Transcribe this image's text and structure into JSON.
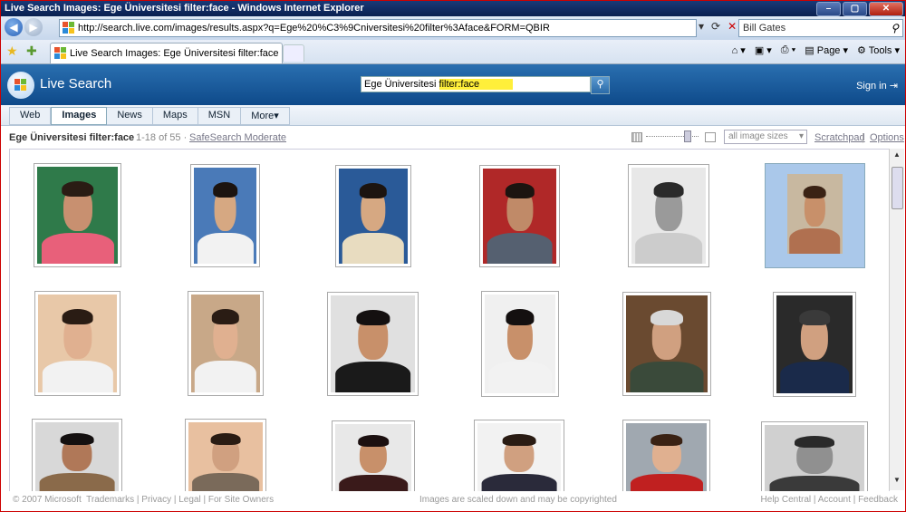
{
  "window": {
    "title": "Live Search Images: Ege Üniversitesi filter:face - Windows Internet Explorer"
  },
  "addressbar": {
    "url": "http://search.live.com/images/results.aspx?q=Ege%20%C3%9Cniversitesi%20filter%3Aface&FORM=QBIR",
    "search_value": "Bill Gates"
  },
  "tab": {
    "label": "Live Search Images: Ege Üniversitesi filter:face"
  },
  "commandbar": {
    "page": "Page",
    "tools": "Tools"
  },
  "header": {
    "brand": "Live Search",
    "query_main": "Ege Üniversitesi",
    "query_filter": "filter:face",
    "signin": "Sign in"
  },
  "nav": [
    "Web",
    "Images",
    "News",
    "Maps",
    "MSN",
    "More▾"
  ],
  "results": {
    "query": "Ege Üniversitesi filter:face",
    "count": "1-18 of 55",
    "separator": "·",
    "safesearch": "SafeSearch Moderate",
    "size_select": "all image sizes",
    "scratchpad": "Scratchpad",
    "options": "Options",
    "pipe": "|"
  },
  "images": [
    {
      "bg": "#2f7a4a",
      "skin": "#c89070",
      "hair": "#2a1c14",
      "shirt": "#e8607a"
    },
    {
      "bg": "#4a7ab8",
      "skin": "#d6a882",
      "hair": "#1c1410",
      "shirt": "#f2f2f2"
    },
    {
      "bg": "#2a5a98",
      "skin": "#d6a882",
      "hair": "#1c1410",
      "shirt": "#e8dcc0"
    },
    {
      "bg": "#b02828",
      "skin": "#c08a68",
      "hair": "#1c1410",
      "shirt": "#556070"
    },
    {
      "bg": "#e8e8e8",
      "skin": "#9a9a9a",
      "hair": "#2a2a2a",
      "shirt": "#cccccc"
    },
    {
      "bg": "#c8b8a0",
      "skin": "#c8906a",
      "hair": "#3a2214",
      "shirt": "#b07050"
    },
    {
      "bg": "#e8c8a8",
      "skin": "#e0b090",
      "hair": "#2a1c14",
      "shirt": "#f2f2f2"
    },
    {
      "bg": "#c8a888",
      "skin": "#e0b090",
      "hair": "#2a1c14",
      "shirt": "#f2f2f2"
    },
    {
      "bg": "#e0e0e0",
      "skin": "#c8906a",
      "hair": "#141010",
      "shirt": "#1a1a1a"
    },
    {
      "bg": "#f0f0f0",
      "skin": "#c8906a",
      "hair": "#141010",
      "shirt": "#f2f2f2"
    },
    {
      "bg": "#6a4a30",
      "skin": "#d0a080",
      "hair": "#d8d8d8",
      "shirt": "#3a4a3a"
    },
    {
      "bg": "#2a2a2a",
      "skin": "#d0a080",
      "hair": "#3a3a3a",
      "shirt": "#1a2a4a"
    },
    {
      "bg": "#d8d8d8",
      "skin": "#b07858",
      "hair": "#141010",
      "shirt": "#8a6a4a"
    },
    {
      "bg": "#e8c0a0",
      "skin": "#d0a080",
      "hair": "#2a1c14",
      "shirt": "#7a6a5a"
    },
    {
      "bg": "#e8e8e8",
      "skin": "#c8906a",
      "hair": "#1c1010",
      "shirt": "#3a1a1a"
    },
    {
      "bg": "#f2f2f2",
      "skin": "#d0a080",
      "hair": "#2a1c14",
      "shirt": "#2a2a3a"
    },
    {
      "bg": "#a0a8b0",
      "skin": "#e0b090",
      "hair": "#3a2214",
      "shirt": "#c02020"
    },
    {
      "bg": "#d0d0d0",
      "skin": "#909090",
      "hair": "#2a2a2a",
      "shirt": "#3a3a3a"
    }
  ],
  "footer": {
    "copyright": "© 2007 Microsoft",
    "trademarks": "Trademarks",
    "privacy": "Privacy",
    "legal": "Legal",
    "site_owners": "For Site Owners",
    "notice": "Images are scaled down and may be copyrighted",
    "help": "Help Central",
    "account": "Account",
    "feedback": "Feedback",
    "pipe": "|"
  }
}
